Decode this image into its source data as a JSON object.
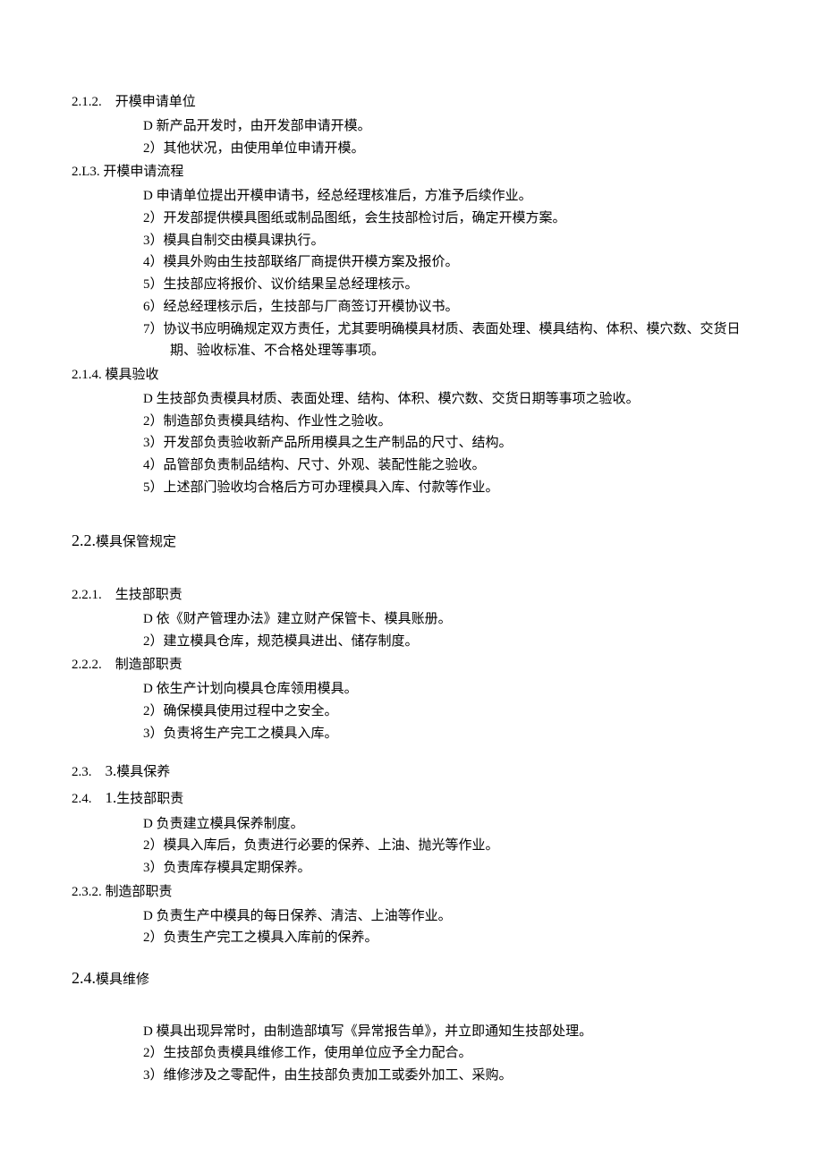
{
  "s212": {
    "title": "2.1.2.　开模申请单位",
    "items": [
      "D 新产品开发时，由开发部申请开模。",
      "2）其他状况，由使用单位申请开模。"
    ]
  },
  "s213": {
    "title": "2.L3. 开模申请流程",
    "items": [
      "D 申请单位提出开模申请书，经总经理核准后，方准予后续作业。",
      "2）开发部提供模具图纸或制品图纸，会生技部检讨后，确定开模方案。",
      "3）模具自制交由模具课执行。",
      "4）模具外购由生技部联络厂商提供开模方案及报价。",
      "5）生技部应将报价、议价结果呈总经理核示。",
      "6）经总经理核示后，生技部与厂商签订开模协议书。",
      "7）协议书应明确规定双方责任，尤其要明确模具材质、表面处理、模具结构、体积、模穴数、交货日期、验收标准、不合格处理等事项。"
    ]
  },
  "s214": {
    "title": "2.1.4. 模具验收",
    "items": [
      "D 生技部负责模具材质、表面处理、结构、体积、模穴数、交货日期等事项之验收。",
      "2）制造部负责模具结构、作业性之验收。",
      "3）开发部负责验收新产品所用模具之生产制品的尺寸、结构。",
      "4）品管部负责制品结构、尺寸、外观、装配性能之验收。",
      "5）上述部门验收均合格后方可办理模具入库、付款等作业。"
    ]
  },
  "s22": {
    "num": "2.2.",
    "title": "模具保管规定"
  },
  "s221": {
    "title": "2.2.1.　生技部职责",
    "items": [
      "D 依《财产管理办法》建立财产保管卡、模具账册。",
      "2）建立模具仓库，规范模具进出、储存制度。"
    ]
  },
  "s222": {
    "title": "2.2.2.　制造部职责",
    "items": [
      "D 依生产计划向模具仓库领用模具。",
      "2）确保模具使用过程中之安全。",
      "3）负责将生产完工之模具入库。"
    ]
  },
  "s23": {
    "prefix": "2.3.　",
    "num": "3.",
    "title": "模具保养"
  },
  "s241": {
    "prefix": "2.4.　",
    "num": "1.",
    "title": "生技部职责",
    "items": [
      "D 负责建立模具保养制度。",
      "2）模具入库后，负责进行必要的保养、上油、抛光等作业。",
      "3）负责库存模具定期保养。"
    ]
  },
  "s232": {
    "title": "2.3.2. 制造部职责",
    "items": [
      "D 负责生产中模具的每日保养、清洁、上油等作业。",
      "2）负责生产完工之模具入库前的保养。"
    ]
  },
  "s24": {
    "num": "2.4.",
    "title": "模具维修",
    "items": [
      "D 模具出现异常时，由制造部填写《异常报告单》，并立即通知生技部处理。",
      "2）生技部负责模具维修工作，使用单位应予全力配合。",
      "3）维修涉及之零配件，由生技部负责加工或委外加工、采购。"
    ]
  }
}
